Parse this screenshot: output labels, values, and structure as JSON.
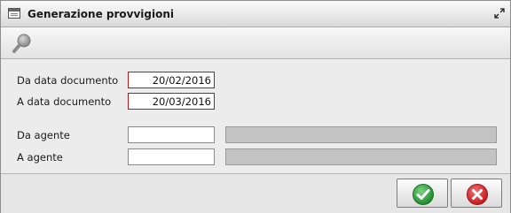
{
  "window": {
    "title": "Generazione provvigioni",
    "title_icon": "window-icon",
    "restore_icon": "restore-window-icon"
  },
  "toolbar": {
    "search_icon": "search-icon"
  },
  "form": {
    "from_date_label": "Da data documento",
    "from_date_value": "20/02/2016",
    "to_date_label": "A data documento",
    "to_date_value": "20/03/2016",
    "from_agent_label": "Da agente",
    "from_agent_value": "",
    "to_agent_label": "A agente",
    "to_agent_value": ""
  },
  "footer": {
    "confirm_icon": "check-icon",
    "cancel_icon": "cancel-icon",
    "colors": {
      "confirm": "#2e9b3a",
      "cancel": "#d9262a"
    }
  }
}
